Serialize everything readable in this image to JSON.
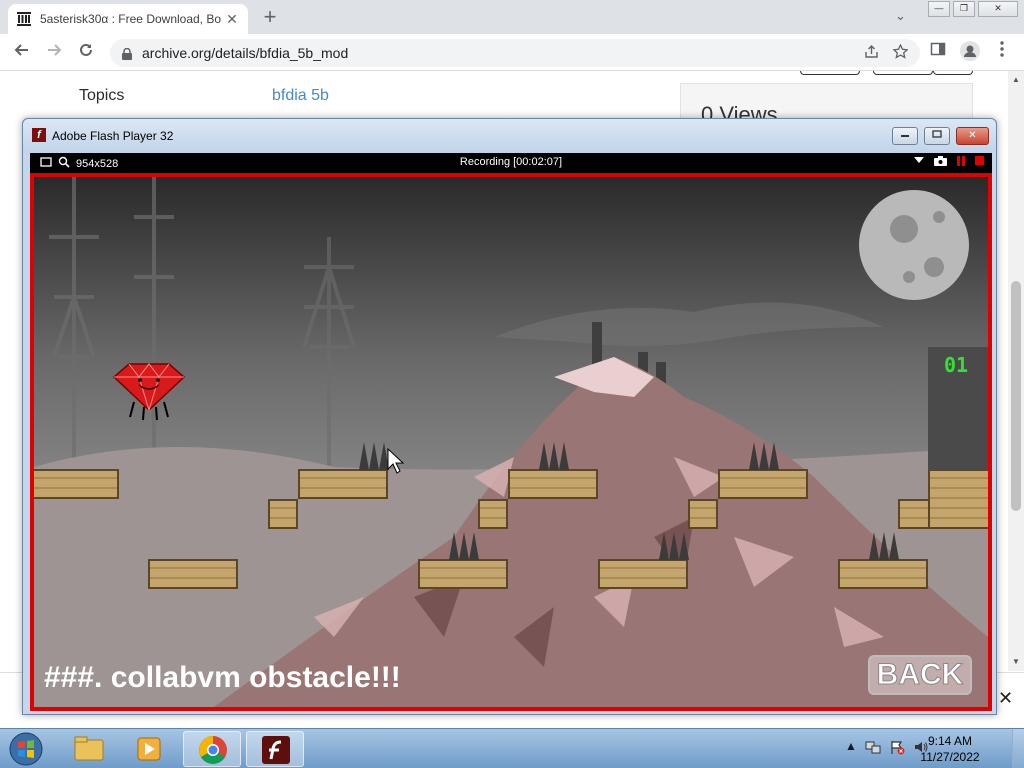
{
  "browser": {
    "tab_title": "5asterisk30α : Free Download, Bo",
    "tab_close": "✕",
    "new_tab": "+",
    "tab_search": "⌄",
    "url": "archive.org/details/bfdia_5b_mod",
    "window_controls": {
      "minimize": "—",
      "restore": "❐",
      "close": "✕"
    }
  },
  "page": {
    "topics_label": "Topics",
    "topics_value": "bfdia 5b",
    "views": "0 Views"
  },
  "flash_window": {
    "title": "Adobe Flash Player 32",
    "controls": {
      "minimize": "▭",
      "maximize": "▭",
      "close": "✕"
    },
    "recorder": {
      "size": "954x528",
      "status": "Recording [00:02:07]"
    },
    "game": {
      "caption": "###. collabvm obstacle!!!",
      "back_button": "BACK",
      "counter": "01"
    }
  },
  "taskbar": {
    "time": "9:14 AM",
    "date": "11/27/2022",
    "tray_expand": "▲"
  },
  "colors": {
    "record_border": "#e00000",
    "counter": "#32e232",
    "link": "#428bca"
  }
}
